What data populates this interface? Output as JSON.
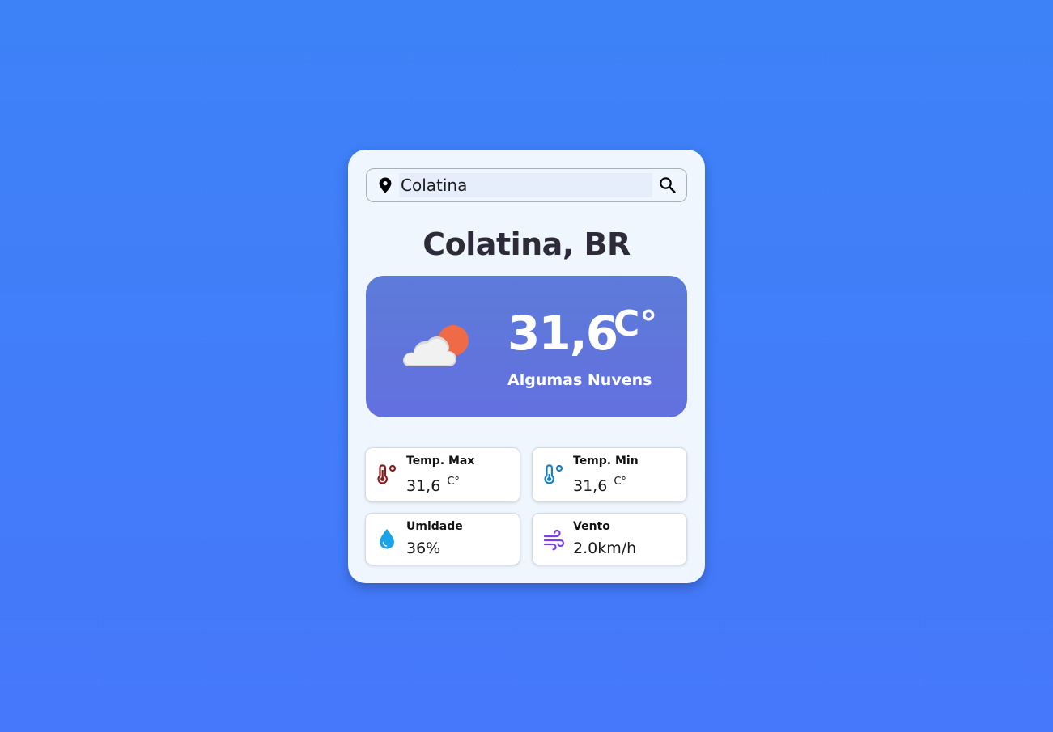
{
  "search": {
    "value": "Colatina",
    "icon": "map-pin-icon",
    "button_icon": "search-icon"
  },
  "location": {
    "title": "Colatina, BR"
  },
  "current": {
    "temperature": "31,6",
    "unit": "C°",
    "description": "Algumas Nuvens",
    "icon": "partly-cloudy-icon"
  },
  "details": {
    "max": {
      "label": "Temp. Max",
      "value": "31,6",
      "unit": "C°",
      "icon": "thermometer-hot-icon",
      "color": "#8b1c1c"
    },
    "min": {
      "label": "Temp. Min",
      "value": "31,6",
      "unit": "C°",
      "icon": "thermometer-cold-icon",
      "color": "#1c7fbf"
    },
    "humidity": {
      "label": "Umidade",
      "value": "36%",
      "icon": "water-drop-icon",
      "color": "#1aa3e8"
    },
    "wind": {
      "label": "Vento",
      "value": "2.0km/h",
      "icon": "wind-icon",
      "color": "#7b3fe4"
    }
  },
  "colors": {
    "background": "#4280f8",
    "card": "#eff6fd",
    "hero": "#5f76dc",
    "title": "#2d2a3a"
  }
}
